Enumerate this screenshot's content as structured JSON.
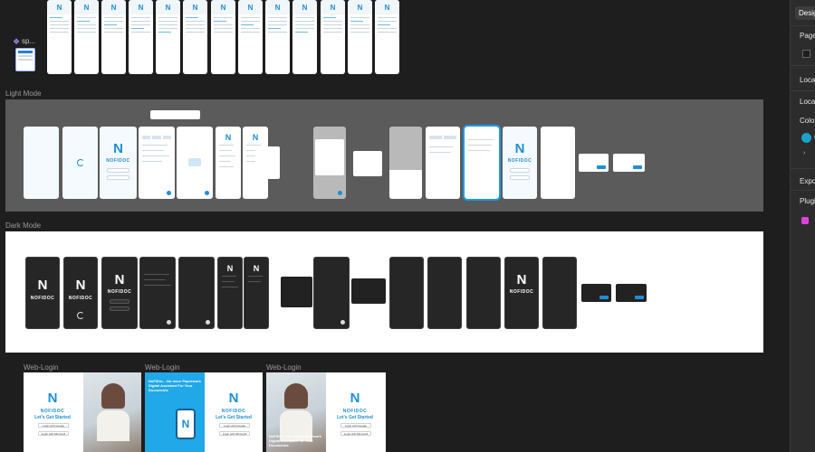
{
  "right_panel": {
    "tab": "Design",
    "items": [
      "Page",
      "Local",
      "Local",
      "Color",
      "Expo",
      "Plugi"
    ],
    "color_letter": "t"
  },
  "component": {
    "name": "sp..."
  },
  "sections": {
    "light": "Light Mode",
    "dark": "Dark Mode",
    "web1": "Web-Login",
    "web2": "Web-Login",
    "web3": "Web-Login"
  },
  "brand": {
    "logo_letter": "N",
    "name": "NOFIDOC",
    "accent": "#1d8fd6"
  },
  "web": {
    "tagline": "Let's Get Started",
    "google_btn": "Login with Google",
    "microsoft_btn": "Login with Microsoft",
    "headline": "NoFiDoc - No more Paperwork Digital Assistant For Your Documents",
    "headline_card3": "NoFiDoc - No more Paperwork Digital Assistant For Your Documents"
  }
}
